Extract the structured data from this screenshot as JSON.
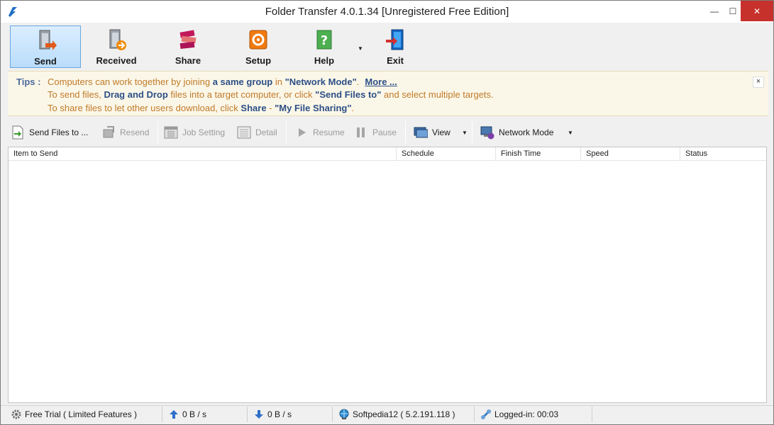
{
  "window": {
    "title": "Folder Transfer 4.0.1.34   [Unregistered Free Edition]",
    "controls": {
      "minimize": "—",
      "maximize": "☐",
      "close": "✕"
    }
  },
  "main_toolbar": {
    "buttons": [
      {
        "label": "Send",
        "icon": "send-icon",
        "active": true
      },
      {
        "label": "Received",
        "icon": "received-icon"
      },
      {
        "label": "Share",
        "icon": "share-icon"
      },
      {
        "label": "Setup",
        "icon": "setup-icon"
      },
      {
        "label": "Help",
        "icon": "help-icon"
      },
      {
        "label": "Exit",
        "icon": "exit-icon"
      }
    ],
    "help_caret": "▼"
  },
  "tips": {
    "label": "Tips :",
    "line1": {
      "a": "Computers can work together by joining ",
      "b": "a same group",
      "c": " in ",
      "d": "\"Network Mode\"",
      "e": ".",
      "more": "More ..."
    },
    "line2": {
      "a": "To send files, ",
      "b": "Drag and Drop",
      "c": " files into a target computer, or click ",
      "d": "\"Send Files to\"",
      "e": " and select multiple targets."
    },
    "line3": {
      "a": "To share files to let other users download, click ",
      "b": "Share",
      "c": " - ",
      "d": "\"My File Sharing\"",
      "e": "."
    },
    "close": "×"
  },
  "action_toolbar": {
    "send_files": "Send Files to ...",
    "resend": "Resend",
    "job_setting": "Job Setting",
    "detail": "Detail",
    "resume": "Resume",
    "pause": "Pause",
    "view": "View",
    "network_mode": "Network Mode",
    "caret": "▼"
  },
  "grid": {
    "columns": [
      "Item to Send",
      "Schedule",
      "Finish Time",
      "Speed",
      "Status"
    ],
    "rows": []
  },
  "statusbar": {
    "trial": "Free Trial ( Limited Features )",
    "upload": "0 B / s",
    "download": "0 B / s",
    "host": "Softpedia12 ( 5.2.191.118 )",
    "logged": "Logged-in: 00:03"
  },
  "colors": {
    "accent": "#2d4f86",
    "tip_text": "#c07a2a",
    "close_red": "#c7312b",
    "active_btn": "#b9dcfb"
  }
}
